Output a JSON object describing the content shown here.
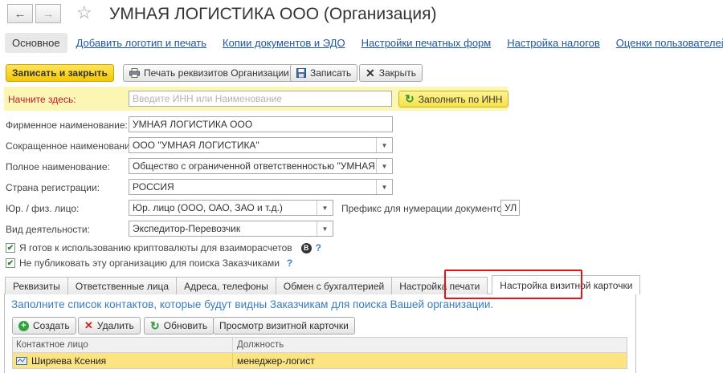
{
  "header": {
    "title": "УМНАЯ ЛОГИСТИКА ООО (Организация)",
    "back_icon": "←",
    "forward_icon": "→",
    "star_icon": "☆"
  },
  "section_tabs": [
    {
      "label": "Основное",
      "active": true
    },
    {
      "label": "Добавить логотип и печать"
    },
    {
      "label": "Копии документов и ЭДО"
    },
    {
      "label": "Настройки печатных форм"
    },
    {
      "label": "Настройка налогов"
    },
    {
      "label": "Оценки пользователей"
    }
  ],
  "toolbar": {
    "save_close": "Записать и закрыть",
    "print_details": "Печать реквизитов Организации",
    "save": "Записать",
    "close": "Закрыть"
  },
  "start": {
    "label": "Начните здесь:",
    "placeholder": "Введите ИНН или Наименование",
    "fill_button": "Заполнить по ИНН"
  },
  "form": {
    "brand_label": "Фирменное наименование:",
    "brand_value": "УМНАЯ ЛОГИСТИКА ООО",
    "short_label": "Сокращенное наименование:",
    "short_value": "ООО \"УМНАЯ ЛОГИСТИКА\"",
    "full_label": "Полное наименование:",
    "full_value": "Общество с ограниченной ответственностью \"УМНАЯ ЛОГ",
    "country_label": "Страна регистрации:",
    "country_value": "РОССИЯ",
    "entity_label": "Юр. / физ. лицо:",
    "entity_value": "Юр. лицо (ООО, ОАО, ЗАО и т.д.)",
    "prefix_label": "Префикс для нумерации документов :",
    "prefix_value": "УЛ",
    "activity_label": "Вид деятельности:",
    "activity_value": "Экспедитор-Перевозчик",
    "crypto_label": "Я готов к использованию криптовалюты для взаиморасчетов",
    "crypto_checked": true,
    "nopublish_label": "Не публиковать эту организацию для поиска Заказчиками",
    "nopublish_checked": true,
    "help": "?",
    "bitcoin_symbol": "B"
  },
  "tabs": [
    {
      "label": "Реквизиты"
    },
    {
      "label": "Ответственные лица"
    },
    {
      "label": "Адреса, телефоны"
    },
    {
      "label": "Обмен с бухгалтерией"
    },
    {
      "label": "Настройка печати"
    },
    {
      "label": "Настройка визитной карточки",
      "active": true
    }
  ],
  "card": {
    "hint": "Заполните список контактов, которые будут видны Заказчикам для поиска Вашей организации.",
    "create": "Создать",
    "delete": "Удалить",
    "refresh": "Обновить",
    "preview": "Просмотр визитной карточки",
    "columns": [
      "Контактное лицо",
      "Должность"
    ],
    "rows": [
      {
        "contact": "Ширяева Ксения",
        "position": "менеджер-логист"
      }
    ]
  },
  "colors": {
    "highlight_border": "#e0141b",
    "accent_yellow": "#f5c800",
    "link_blue": "#1f55a4"
  }
}
